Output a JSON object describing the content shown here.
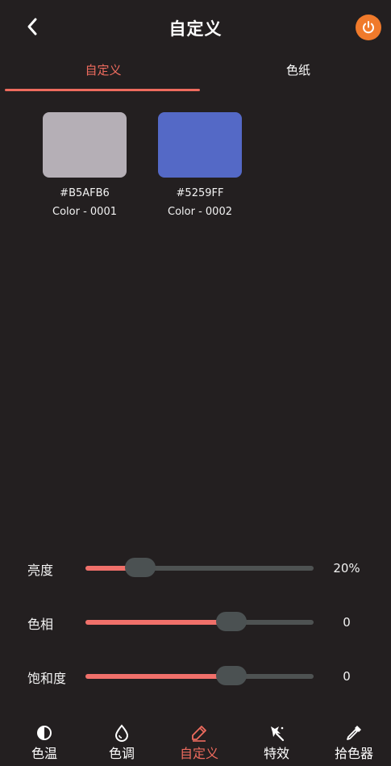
{
  "header": {
    "title": "自定义"
  },
  "tabs": [
    {
      "label": "自定义",
      "active": true
    },
    {
      "label": "色纸",
      "active": false
    }
  ],
  "swatches": [
    {
      "hex": "#B5AFB6",
      "name": "Color - 0001",
      "color": "#B5AFB6"
    },
    {
      "hex": "#5259FF",
      "name": "Color - 0002",
      "color": "#5469C6"
    }
  ],
  "sliders": [
    {
      "label": "亮度",
      "value_text": "20%",
      "level": 0.24
    },
    {
      "label": "色相",
      "value_text": "0",
      "level": 0.64
    },
    {
      "label": "饱和度",
      "value_text": "0",
      "level": 0.64
    }
  ],
  "bottom_nav": [
    {
      "label": "色温",
      "icon": "half-circle-icon",
      "active": false
    },
    {
      "label": "色调",
      "icon": "droplet-icon",
      "active": false
    },
    {
      "label": "自定义",
      "icon": "pen-icon",
      "active": true
    },
    {
      "label": "特效",
      "icon": "magic-wand-icon",
      "active": false
    },
    {
      "label": "拾色器",
      "icon": "eyedropper-icon",
      "active": false
    }
  ],
  "colors": {
    "accent": "#EE6B5E",
    "power": "#F07A2B",
    "background": "#231F20"
  }
}
